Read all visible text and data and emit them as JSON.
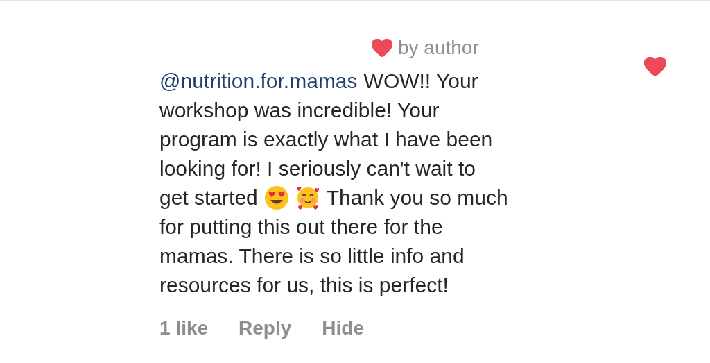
{
  "badge": {
    "text": "by author"
  },
  "like_button": {
    "liked": true
  },
  "comment": {
    "lines": [
      {
        "mention": "@nutrition.for.mamas",
        "text": "WOW!! Your"
      },
      {
        "text": "workshop was incredible! Your"
      },
      {
        "text": "program is exactly what I have been"
      },
      {
        "text": "looking for! I seriously can't wait to"
      },
      {
        "text": "get started",
        "emojis": [
          {
            "kind": "heart-eyes"
          },
          {
            "kind": "smiling-hearts"
          }
        ],
        "text_after": "Thank you so much"
      },
      {
        "text": "for putting this out there for the"
      },
      {
        "text": "mamas. There is so little info and"
      },
      {
        "text": "resources for us, this is perfect!"
      }
    ]
  },
  "likes": "1 like",
  "actions": [
    "Reply",
    "Hide"
  ]
}
